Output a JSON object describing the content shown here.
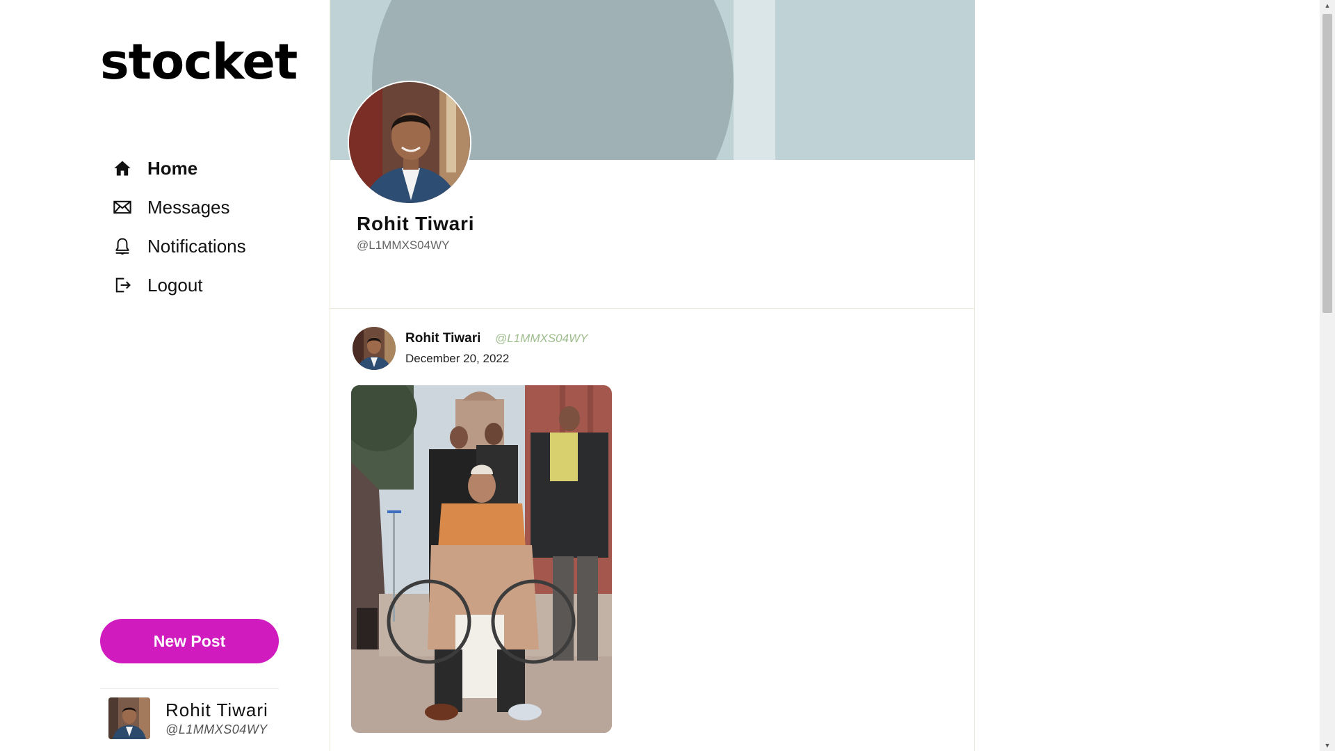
{
  "brand": {
    "logo_text": "stocket"
  },
  "nav": {
    "items": [
      {
        "label": "Home",
        "icon": "home-icon",
        "active": true
      },
      {
        "label": "Messages",
        "icon": "envelope-icon",
        "active": false
      },
      {
        "label": "Notifications",
        "icon": "bell-icon",
        "active": false
      },
      {
        "label": "Logout",
        "icon": "logout-icon",
        "active": false
      }
    ]
  },
  "new_post_label": "New Post",
  "current_user": {
    "name": "Rohit Tiwari",
    "handle": "@L1MMXS04WY"
  },
  "profile": {
    "name": "Rohit Tiwari",
    "handle": "@L1MMXS04WY"
  },
  "post": {
    "author": "Rohit Tiwari",
    "handle": "@L1MMXS04WY",
    "date": "December 20, 2022"
  },
  "colors": {
    "accent": "#d01bbf",
    "handle_green": "#9ebd8d",
    "banner": "#bfd3d6"
  }
}
